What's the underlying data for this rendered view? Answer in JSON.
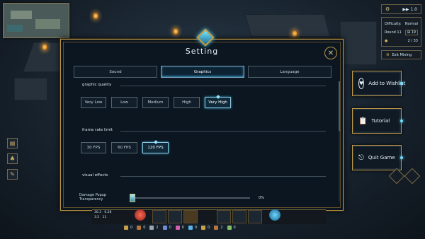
{
  "hud": {
    "speed": "1.0",
    "difficulty_label": "Difficulty:",
    "difficulty_value": "Normal",
    "round_label": "Round",
    "round_value": "11",
    "wave_value": "19",
    "progress_text": "2 / 33",
    "exit_label": "Exit Mining"
  },
  "side_buttons": {
    "wishlist": "Add to Wishlist",
    "tutorial": "Tutorial",
    "quit": "Quit Game"
  },
  "dialog": {
    "title": "Setting",
    "close_glyph": "✕",
    "tabs": [
      {
        "label": "Sound",
        "active": false
      },
      {
        "label": "Graphics",
        "active": true
      },
      {
        "label": "Language",
        "active": false
      }
    ],
    "graphic_quality": {
      "title": "graphic quality",
      "options": [
        "Very Low",
        "Low",
        "Medium",
        "High",
        "Very High"
      ],
      "selected": "Very High"
    },
    "frame_rate": {
      "title": "frame rate limit",
      "options": [
        "30 FPS",
        "60 FPS",
        "120 FPS"
      ],
      "selected": "120 FPS"
    },
    "visual_effects": {
      "title": "visual effects",
      "damage_popup_label": "Damage Popup Transparency",
      "damage_popup_value": "0%",
      "damage_popup_level": 0
    }
  },
  "bottom_stats": {
    "left_a": "30.3",
    "left_b": "0.28",
    "left_c": "3.5",
    "left_d": "11",
    "resources": [
      "0",
      "0",
      "2",
      "0",
      "0",
      "0",
      "0",
      "2",
      "0"
    ]
  },
  "colors": {
    "accent_gold": "#b89447",
    "accent_cyan": "#6fe0ff",
    "panel_bg": "#0b1620"
  },
  "icons": [
    "settings-gear-icon",
    "speed-icon",
    "wishlist-icon",
    "tutorial-icon",
    "quit-icon",
    "close-icon",
    "crest-icon"
  ]
}
